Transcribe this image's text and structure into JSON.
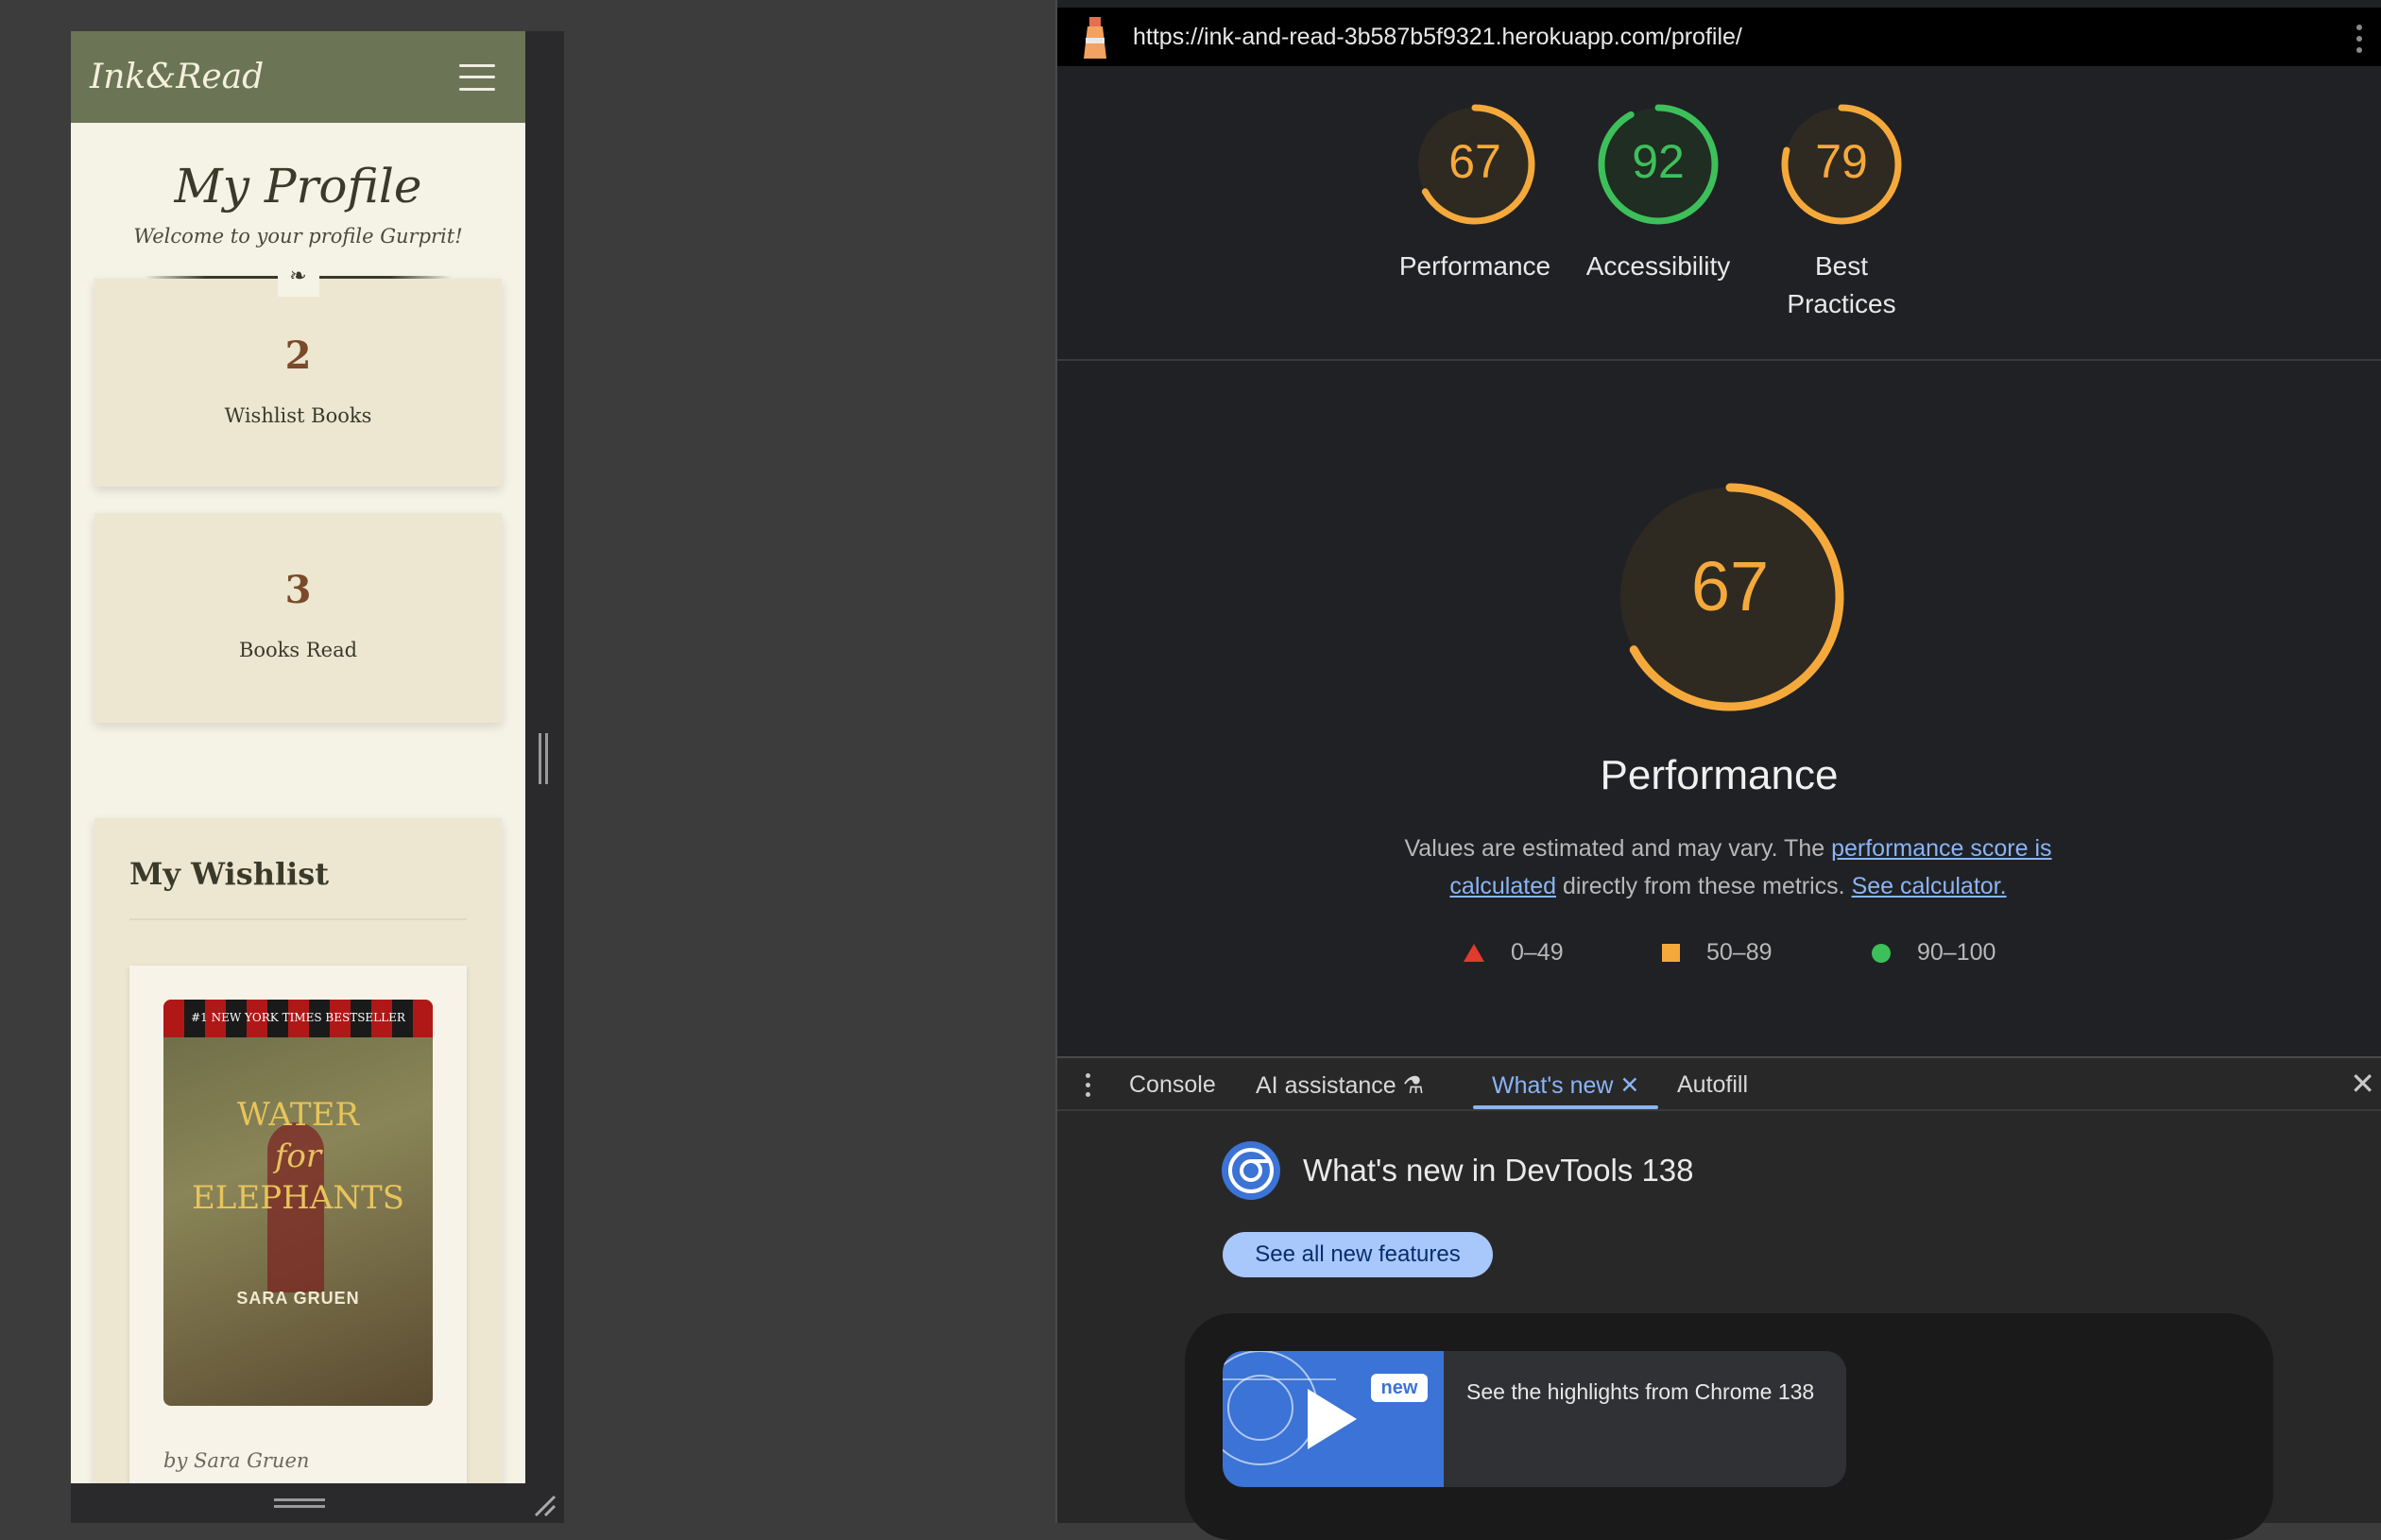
{
  "site": {
    "brand": "Ink&Read",
    "profile_title": "My Profile",
    "welcome": "Welcome to your profile Gurprit!",
    "divider_ornament": "❧",
    "stats": [
      {
        "value": "2",
        "label": "Wishlist Books"
      },
      {
        "value": "3",
        "label": "Books Read"
      }
    ],
    "wishlist_title": "My Wishlist",
    "book": {
      "banner": "#1 NEW YORK TIMES BESTSELLER",
      "cover_title_1": "WATER",
      "cover_title_2": "for",
      "cover_title_3": "ELEPHANTS",
      "cover_author": "SARA GRUEN",
      "byline": "by Sara Gruen"
    }
  },
  "devtools": {
    "url": "https://ink-and-read-3b587b5f9321.herokuapp.com/profile/",
    "scores": [
      {
        "value": "67",
        "label": "Performance",
        "color": "#f6a93b",
        "pct": 0.67
      },
      {
        "value": "92",
        "label": "Accessibility",
        "color": "#3dc05a",
        "pct": 0.92
      },
      {
        "value": "79",
        "label": "Best Practices",
        "color": "#f6a93b",
        "pct": 0.79
      }
    ],
    "main_score": {
      "value": "67",
      "pct": 0.67,
      "color": "#f6a93b"
    },
    "performance_title": "Performance",
    "desc_prefix": "Values are estimated and may vary. The ",
    "desc_link1": "performance score is calculated",
    "desc_middle": " directly from these metrics. ",
    "desc_link2": "See calculator.",
    "legend": [
      {
        "label": "0–49",
        "shape": "triangle",
        "color": "#e23a2e"
      },
      {
        "label": "50–89",
        "shape": "square",
        "color": "#f6a93b"
      },
      {
        "label": "90–100",
        "shape": "circle",
        "color": "#3dc05a"
      }
    ],
    "drawer_tabs": [
      "Console",
      "AI assistance",
      "What's new",
      "Autofill"
    ],
    "active_tab": "What's new",
    "whats_new_title": "What's new in DevTools 138",
    "see_all_button": "See all new features",
    "video_badge": "new",
    "video_text": "See the highlights from Chrome 138"
  }
}
